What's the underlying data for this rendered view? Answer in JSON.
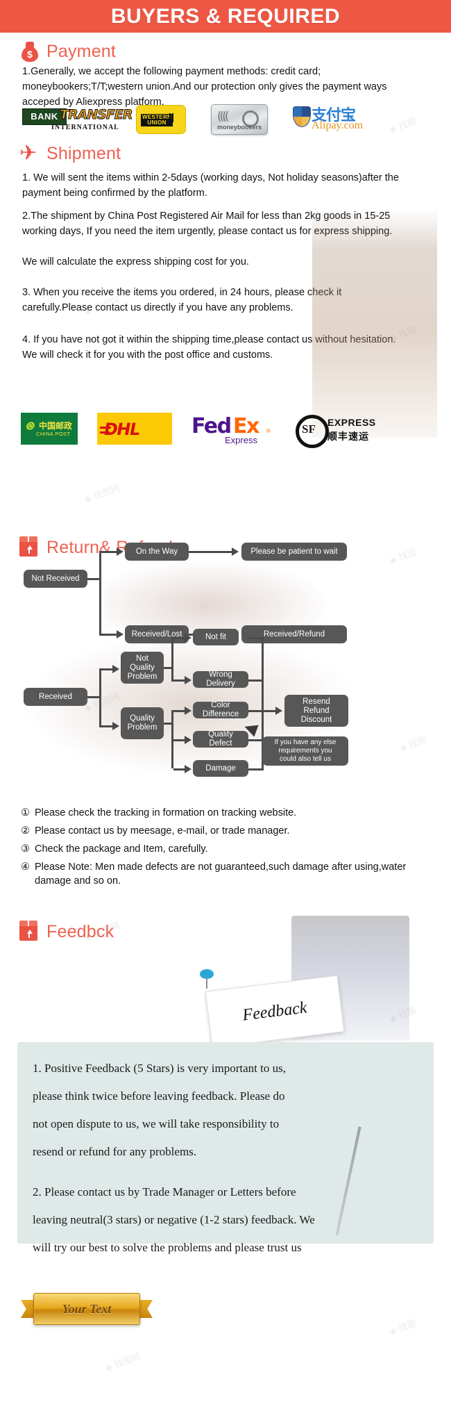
{
  "banner": {
    "title": "BUYERS & REQUIRED"
  },
  "payment": {
    "heading": "Payment",
    "icon": "money-bag-icon",
    "paragraph": "1.Generally, we accept the following payment methods: credit card; moneybookers;T/T;western union.And our protection only gives the payment ways acceped by Aliexpress platform.",
    "logos": [
      {
        "name": "bank-transfer-logo",
        "primary": "BANK",
        "secondary": "TRANSFER",
        "sub": "INTERNATIONAL"
      },
      {
        "name": "western-union-logo",
        "line1": "WESTERN",
        "line2": "UNION"
      },
      {
        "name": "moneybookers-logo",
        "label": "moneybookers"
      },
      {
        "name": "alipay-logo",
        "cn": "支付宝",
        "domain": "Alipay.com"
      }
    ]
  },
  "shipment": {
    "heading": "Shipment",
    "icon": "airplane-icon",
    "paragraphs": [
      "1. We will sent the items within 2-5days (working days, Not holiday seasons)after the payment being confirmed by the platform.",
      "2.The shipment by China Post Registered Air Mail for less than  2kg goods in 15-25 working days, If  you need the item urgently, please contact us for express shipping.",
      "We will calculate the express shipping cost for you.",
      "3. When you receive the items you ordered, in 24 hours, please check  it carefully.Please contact us directly if you have any problems.",
      "4. If you have not got it within the shipping time,please contact us without hesitation. We will check it for you with the post office and customs."
    ],
    "logos": [
      {
        "name": "china-post-logo",
        "cn": "中国邮政",
        "en": "CHINA POST"
      },
      {
        "name": "dhl-logo",
        "text": "DHL"
      },
      {
        "name": "fedex-logo",
        "fed": "Fed",
        "ex": "Ex",
        "sub": "Express",
        "reg": "®"
      },
      {
        "name": "sf-express-logo",
        "mark": "SF",
        "en": "EXPRESS",
        "cn": "顺丰速运"
      }
    ]
  },
  "returns": {
    "heading": "Return& Refund",
    "icon": "return-box-icon",
    "flow": {
      "not_received": "Not Received",
      "on_the_way": "On the Way",
      "please_wait": "Please be patient to wait",
      "received_lost": "Received/Lost",
      "received_refund": "Received/Refund",
      "received": "Received",
      "not_quality_problem": "Not\nQuality\nProblem",
      "quality_problem": "Quality\nProblem",
      "not_fit": "Not fit",
      "wrong_delivery": "Wrong Delivery",
      "color_difference": "Color Difference",
      "quality_defect": "Quality Defect",
      "damage": "Damage",
      "resend_refund_discount": "Resend\nRefund\nDiscount",
      "else_requirements": "If you have any else\nrequirements you\ncould also tell us"
    },
    "notes": [
      {
        "num": "①",
        "text": "Please check the tracking in formation on tracking website."
      },
      {
        "num": "②",
        "text": "Please contact us by meesage, e-mail, or trade manager."
      },
      {
        "num": "③",
        "text": "Check the package and Item, carefully."
      },
      {
        "num": "④",
        "text": "Please Note: Men made defects  are not guaranteed,such damage after using,water damage and so on."
      }
    ]
  },
  "feedback": {
    "heading": "Feedbck",
    "icon": "feedback-box-icon",
    "card_label": "Feedback",
    "paragraphs": [
      "1. Positive Feedback (5 Stars) is very important to us,",
      "please think twice before leaving feedback. Please do",
      "not open dispute to us,   we will take responsibility to",
      "resend or refund for any problems.",
      "2. Please contact us by Trade Manager or Letters before",
      "leaving neutral(3 stars) or negative (1-2 stars) feedback. We",
      "will try our best to solve the problems and please trust us"
    ]
  },
  "ribbon": {
    "text": "Your Text"
  },
  "colors": {
    "banner_red": "#ee5744",
    "heading_red": "#ee6150",
    "flow_box": "#575757",
    "feedback_panel": "#dfe9e8",
    "ribbon_gold": "#e8a920"
  }
}
